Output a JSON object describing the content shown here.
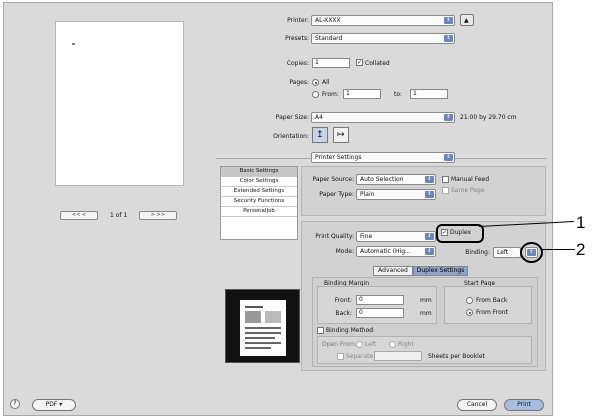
{
  "printer": {
    "label": "Printer:",
    "value": "AL-XXXX"
  },
  "presets": {
    "label": "Presets:",
    "value": "Standard"
  },
  "copies": {
    "label": "Copies:",
    "value": "1",
    "collated_label": "Collated",
    "collated": true
  },
  "pages": {
    "label": "Pages:",
    "all_label": "All",
    "from_label": "From:",
    "from_value": "1",
    "to_label": "to:",
    "to_value": "1"
  },
  "paper_size": {
    "label": "Paper Size:",
    "value": "A4",
    "dimensions": "21.00 by 29.70 cm"
  },
  "orientation": {
    "label": "Orientation:"
  },
  "section_popup": "Printer Settings",
  "pager": {
    "first": "<< <",
    "page_of": "1 of 1",
    "last": "> >>"
  },
  "sidebar_items": [
    "Basic Settings",
    "Color Settings",
    "Extended Settings",
    "Security Functions",
    "PersonalJob"
  ],
  "paper_source": {
    "label": "Paper Source:",
    "value": "Auto Selection",
    "manual_feed_label": "Manual Feed",
    "same_page_label": "Same Page"
  },
  "paper_type": {
    "label": "Paper Type:",
    "value": "Plain"
  },
  "print_quality": {
    "label": "Print Quality:",
    "value": "Fine",
    "duplex_label": "Duplex",
    "duplex": true
  },
  "mode": {
    "label": "Mode:",
    "value": "Automatic (Hig..."
  },
  "binding": {
    "label": "Binding:",
    "value": "Left"
  },
  "tabs": [
    "Advanced",
    "Duplex Settings"
  ],
  "binding_margin": {
    "title": "Binding Margin",
    "front_label": "Front:",
    "front_value": "0",
    "back_label": "Back:",
    "back_value": "0",
    "unit": "mm"
  },
  "start_page": {
    "title": "Start Page",
    "back_label": "From Back",
    "front_label": "From Front"
  },
  "binding_method": {
    "label": "Binding Method"
  },
  "open_from": {
    "label": "Open From:",
    "left_label": "Left",
    "right_label": "Right",
    "separate_label": "Separate",
    "sheets_label": "Sheets per Booklet"
  },
  "bottom": {
    "help": "?",
    "pdf": "PDF ▾",
    "cancel": "Cancel",
    "print": "Print"
  },
  "callouts": [
    "1",
    "2"
  ]
}
